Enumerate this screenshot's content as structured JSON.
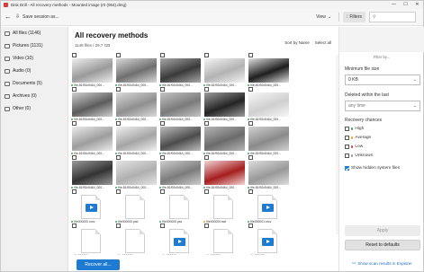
{
  "window": {
    "title": "Disk Drill - All recovery methods - Mounted image (r0 (064).dmg)",
    "controls": [
      "—",
      "☐",
      "✕"
    ]
  },
  "toolbar": {
    "back": "←",
    "save_session": "Save session as...",
    "view_label": "View",
    "filters_label": "Filters"
  },
  "sidebar": {
    "items": [
      {
        "label": "All files (1146)",
        "state": "active"
      },
      {
        "label": "Pictures (1131)",
        "state": "normal"
      },
      {
        "label": "Video (10)",
        "state": "normal"
      },
      {
        "label": "Audio (0)",
        "state": "dim"
      },
      {
        "label": "Documents (5)",
        "state": "normal"
      },
      {
        "label": "Archives (0)",
        "state": "dim"
      },
      {
        "label": "Other (0)",
        "state": "dim"
      }
    ]
  },
  "main": {
    "title": "All recovery methods",
    "subtitle": "1146 files / 29,7 GB",
    "sort_label": "Sort by Name",
    "select_label": "Select all",
    "recover_button": "Recover all..."
  },
  "colors": {
    "accent": "#1f7ad1",
    "chance_high": "#36b24a",
    "chance_average": "#f0a020",
    "chance_low": "#e23b3b"
  },
  "tiles": [
    {
      "name": "file-81f92c5464_000...",
      "kind": "photo",
      "c1": "#9a9a9a",
      "c2": "#eeeeee",
      "chance": "high"
    },
    {
      "name": "file-81f92c5464_000...",
      "kind": "photo",
      "c1": "#6f6f6f",
      "c2": "#d9d9d9",
      "chance": "high"
    },
    {
      "name": "file-81f92c5464_000...",
      "kind": "photo",
      "c1": "#3a3a3a",
      "c2": "#a8a8a8",
      "chance": "high"
    },
    {
      "name": "file-81f92c5464_000...",
      "kind": "photo",
      "c1": "#b3b3b3",
      "c2": "#f4f4f4",
      "chance": "high"
    },
    {
      "name": "file-81f92c5464_000...",
      "kind": "photo",
      "c1": "#1e1e1e",
      "c2": "#e0e0e0",
      "chance": "high"
    },
    {
      "name": "file-81f92c5464_000...",
      "kind": "photo",
      "c1": "#5c5c5c",
      "c2": "#cfcfcf",
      "chance": "high"
    },
    {
      "name": "file-81f92c5464_000...",
      "kind": "photo",
      "c1": "#8f8f8f",
      "c2": "#dadada",
      "chance": "high"
    },
    {
      "name": "file-81f92c5464_000...",
      "kind": "photo",
      "c1": "#7b7b7b",
      "c2": "#c4c4c4",
      "chance": "high"
    },
    {
      "name": "file-81f92c5464_000...",
      "kind": "photo",
      "c1": "#242424",
      "c2": "#9c9c9c",
      "chance": "high"
    },
    {
      "name": "file-81f92c5464_000...",
      "kind": "photo",
      "c1": "#cfcfcf",
      "c2": "#f7f7f7",
      "chance": "high"
    },
    {
      "name": "file-81f92c5464_000...",
      "kind": "photo",
      "c1": "#9d9d9d",
      "c2": "#ececec",
      "chance": "high"
    },
    {
      "name": "file-81f92c5464_000...",
      "kind": "photo",
      "c1": "#a5a5a5",
      "c2": "#f0f0f0",
      "chance": "high"
    },
    {
      "name": "file-81f92c5464_000...",
      "kind": "photo",
      "c1": "#4c4c4c",
      "c2": "#bdbdbd",
      "chance": "high"
    },
    {
      "name": "file-81f92c5464_000...",
      "kind": "photo",
      "c1": "#6b6b6b",
      "c2": "#b6b6b6",
      "chance": "high"
    },
    {
      "name": "file-81f92c5464_000...",
      "kind": "photo",
      "c1": "#8a8a8a",
      "c2": "#d2d2d2",
      "chance": "high"
    },
    {
      "name": "file-81f92c5464_000...",
      "kind": "photo",
      "c1": "#333333",
      "c2": "#9a9a9a",
      "chance": "high"
    },
    {
      "name": "file-81f92c5464_000...",
      "kind": "photo",
      "c1": "#b0b0b0",
      "c2": "#e3e3e3",
      "chance": "high"
    },
    {
      "name": "file-81f92c5464_000...",
      "kind": "photo",
      "c1": "#7c7c7c",
      "c2": "#cdcdcd",
      "chance": "high"
    },
    {
      "name": "file-81f92c5464_000...",
      "kind": "photo",
      "c1": "#a61e1e",
      "c2": "#f2d5d5",
      "chance": "high"
    },
    {
      "name": "file-81f92c5464_000...",
      "kind": "photo",
      "c1": "#999999",
      "c2": "#dddddd",
      "chance": "high"
    },
    {
      "name": "file000000.mov",
      "kind": "video",
      "chance": "high"
    },
    {
      "name": "file000000.psd",
      "kind": "doc",
      "chance": "high"
    },
    {
      "name": "file000000.psx",
      "kind": "doc",
      "chance": "high"
    },
    {
      "name": "file000000.swf",
      "kind": "doc",
      "chance": "average"
    },
    {
      "name": "file000001.mov",
      "kind": "video",
      "chance": "high"
    },
    {
      "name": "file000001.psx",
      "kind": "doc",
      "chance": "high"
    },
    {
      "name": "file000002.psx",
      "kind": "doc",
      "chance": "high"
    },
    {
      "name": "file000002.mov",
      "kind": "video",
      "chance": "high"
    },
    {
      "name": "file000003.psx",
      "kind": "doc",
      "chance": "high"
    },
    {
      "name": "file000003.mov",
      "kind": "video",
      "chance": "high"
    }
  ],
  "filters": {
    "caption": "Filter by...",
    "min_size_label": "Minimum file size",
    "min_size_value": "0 KB",
    "deleted_label": "Deleted within the last",
    "deleted_value": "any time",
    "chances_label": "Recovery chances",
    "chances": [
      {
        "label": "High",
        "color": "#36b24a",
        "checked": false
      },
      {
        "label": "Average",
        "color": "#f0a020",
        "checked": false
      },
      {
        "label": "Low",
        "color": "#e23b3b",
        "checked": false
      },
      {
        "label": "Unknown",
        "color": "#9a9a9a",
        "checked": false
      }
    ],
    "hidden_label": "Show hidden system files",
    "hidden_checked": true,
    "apply_button": "Apply",
    "reset_button": "Reset to defaults",
    "explorer_link": "Show scan results in Explorer"
  }
}
